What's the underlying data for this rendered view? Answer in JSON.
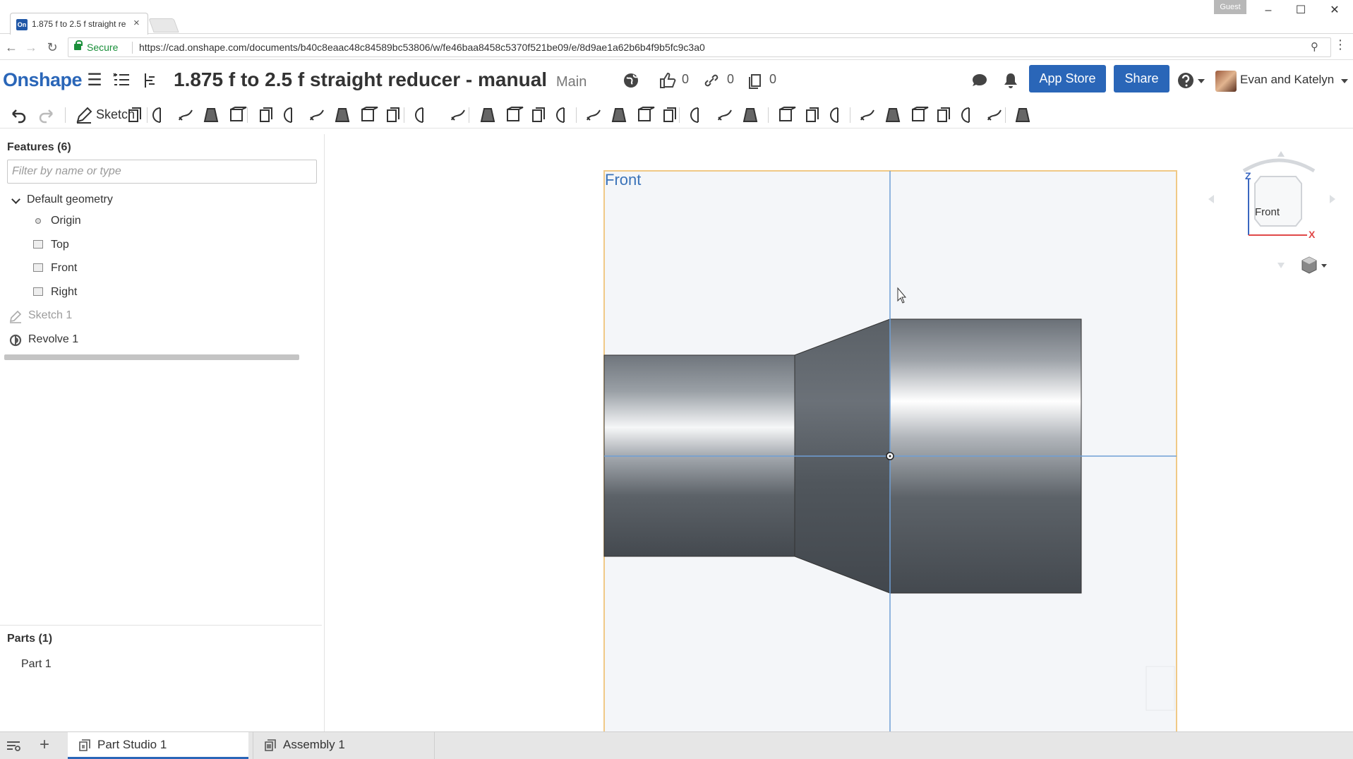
{
  "browser": {
    "tab_title": "1.875 f to 2.5 f straight re",
    "tab_favicon": "On",
    "tab_close": "×",
    "guest_label": "Guest",
    "secure_label": "Secure",
    "url": "https://cad.onshape.com/documents/b40c8eaac48c84589bc53806/w/fe46baa8458c5370f521be09/e/8d9ae1a62b6b4f9b5fc9c3a0",
    "icons": [
      "back-icon",
      "forward-icon",
      "reload-icon",
      "lock-icon",
      "zoom-icon",
      "menu-dots-icon"
    ]
  },
  "header": {
    "logo": "Onshape",
    "document_title": "1.875 f to 2.5 f straight reducer - manual",
    "branch": "Main",
    "likes": "0",
    "links": "0",
    "copies": "0",
    "app_store_label": "App Store",
    "share_label": "Share",
    "user_name": "Evan and Katelyn",
    "help_icon": "?"
  },
  "toolbar": {
    "sketch_label": "Sketch"
  },
  "feature_panel": {
    "title": "Features (6)",
    "filter_placeholder": "Filter by name or type",
    "default_geometry": "Default geometry",
    "items": [
      {
        "label": "Origin",
        "type": "origin"
      },
      {
        "label": "Top",
        "type": "plane"
      },
      {
        "label": "Front",
        "type": "plane"
      },
      {
        "label": "Right",
        "type": "plane"
      }
    ],
    "sketch_1": "Sketch 1",
    "revolve_1": "Revolve 1",
    "parts_title": "Parts (1)",
    "parts": [
      "Part 1"
    ]
  },
  "viewport": {
    "plane_label": "Front",
    "viewcube_face": "Front",
    "axis_z": "Z",
    "axis_x": "X",
    "colors": {
      "plane_border": "#f0c987",
      "plane_fill": "#f4f6f9",
      "axis_line": "#6f9fd6",
      "part_dark": "#4b5056",
      "part_mid": "#7b8188",
      "part_light": "#ffffff"
    }
  },
  "bottom_tabs": [
    {
      "label": "Part Studio 1",
      "active": true
    },
    {
      "label": "Assembly 1",
      "active": false
    }
  ],
  "accent_color": "#2a66b8"
}
